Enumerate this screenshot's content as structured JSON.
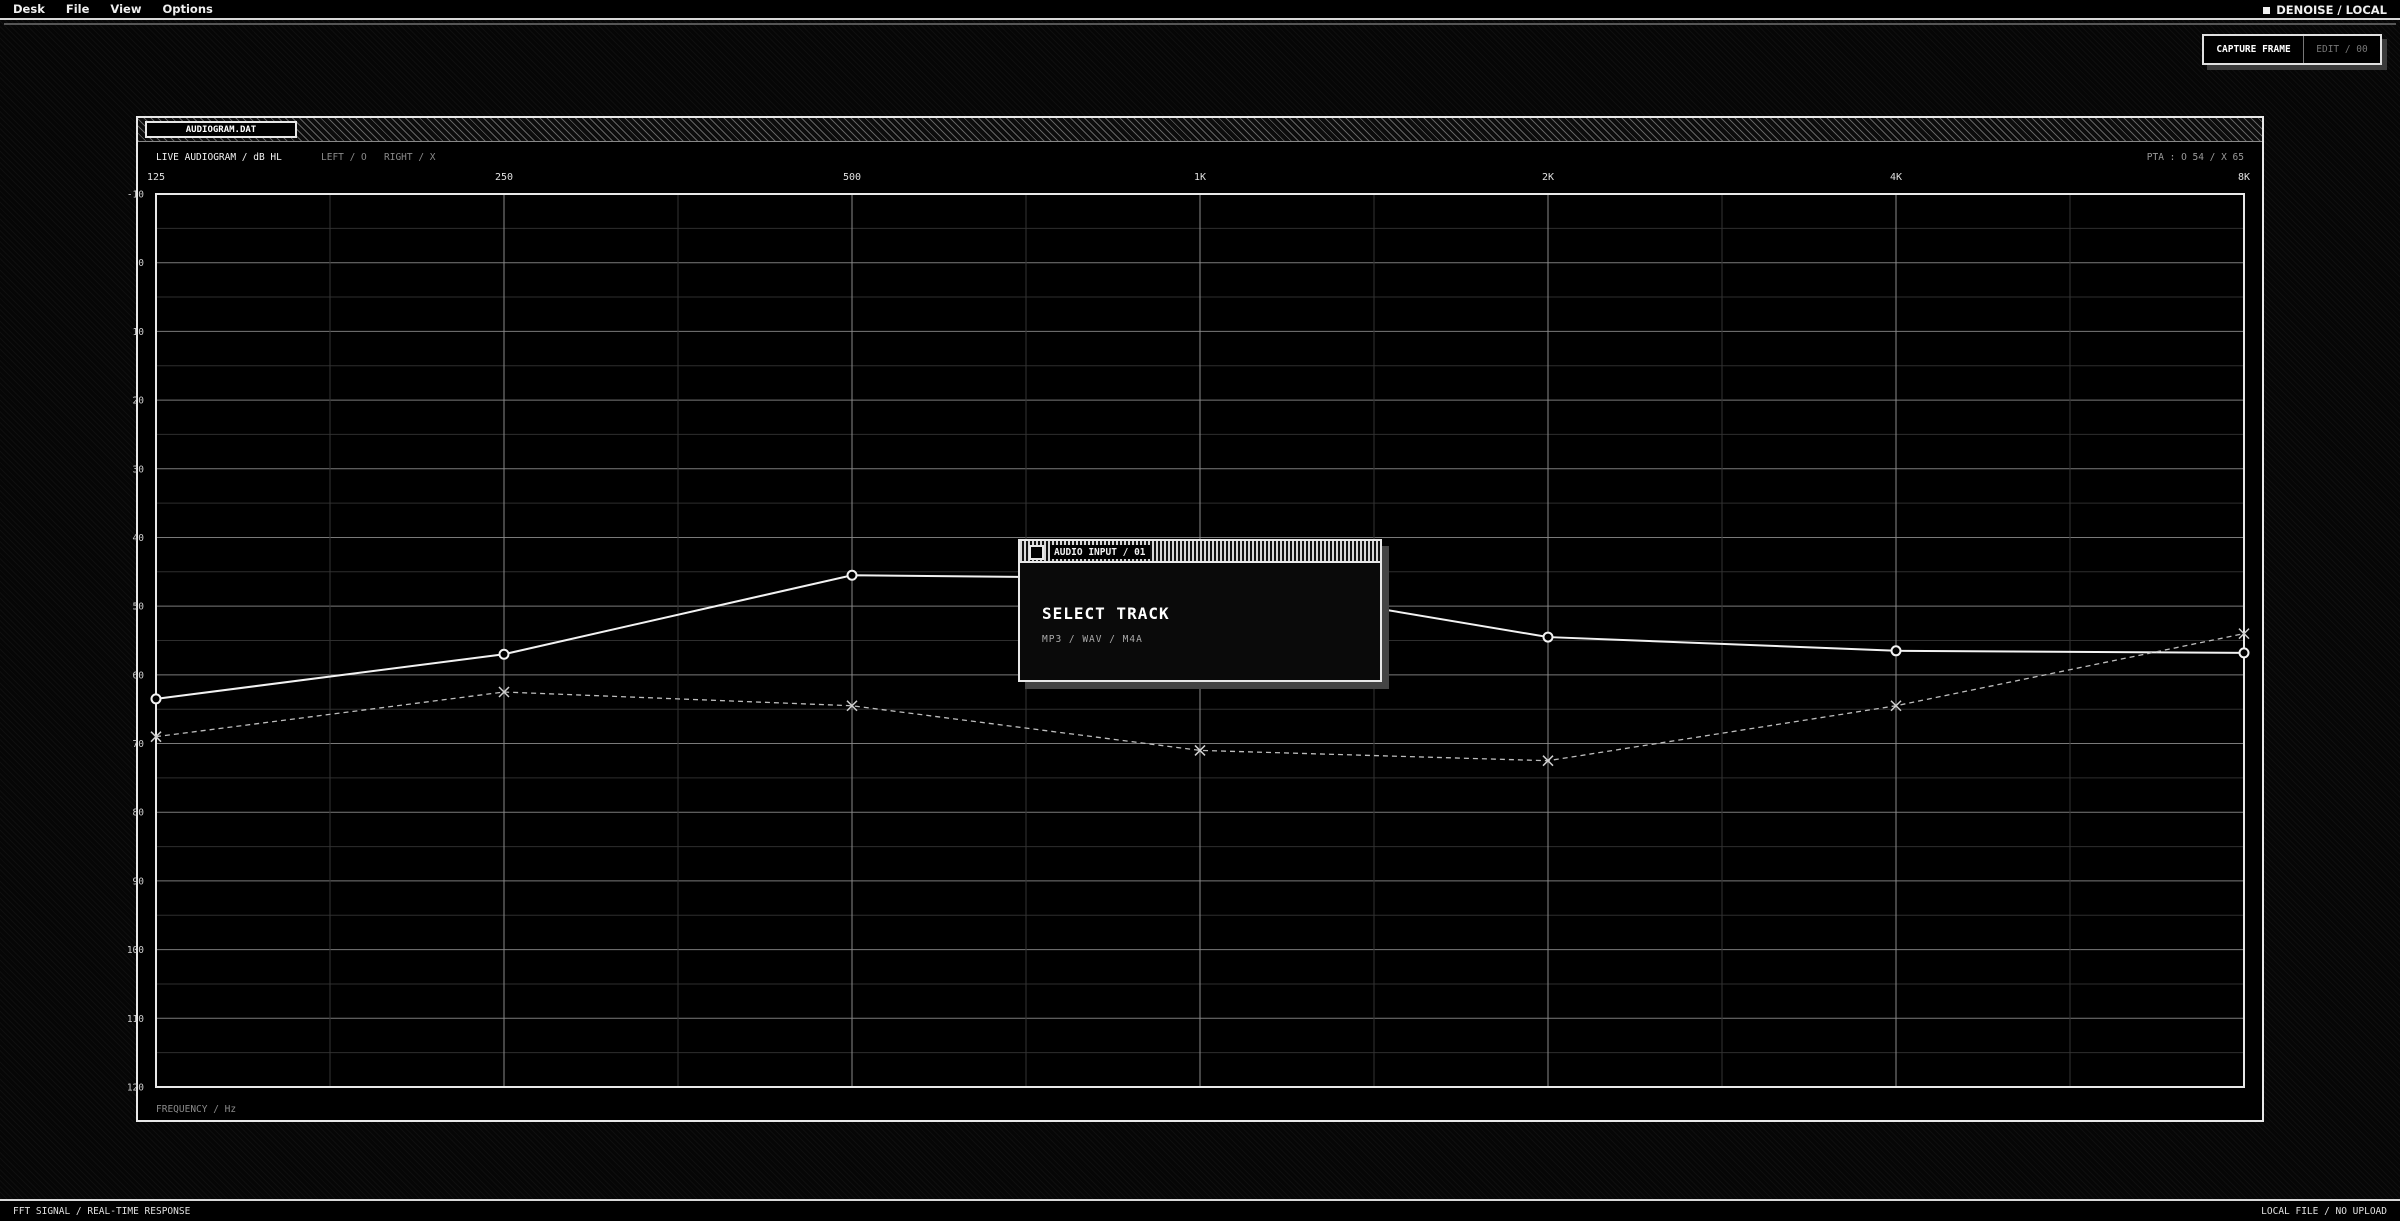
{
  "menubar": {
    "items": [
      "Desk",
      "File",
      "View",
      "Options"
    ],
    "status": "DENOISE / LOCAL"
  },
  "capture": {
    "primary_label": "CAPTURE FRAME",
    "secondary_label": "EDIT / 00"
  },
  "panel": {
    "file_tab": "AUDIOGRAM.DAT",
    "legend_title": "LIVE AUDIOGRAM / dB HL",
    "legend_left": "LEFT / O",
    "legend_right": "RIGHT / X",
    "pta": "PTA : O 54 / X 65",
    "x_caption": "FREQUENCY / Hz"
  },
  "chart_data": {
    "type": "line",
    "x_ticks": [
      "125",
      "250",
      "500",
      "1K",
      "2K",
      "4K",
      "8K"
    ],
    "y_ticks": [
      "-10",
      "0",
      "10",
      "20",
      "30",
      "40",
      "50",
      "60",
      "70",
      "80",
      "90",
      "100",
      "110",
      "120"
    ],
    "ylim": [
      -10,
      120
    ],
    "y_inverted": true,
    "x_scale": "log2",
    "grid": true,
    "series": [
      {
        "name": "LEFT / O",
        "marker": "circle",
        "style": "solid",
        "values": [
          63.5,
          57,
          45.5,
          46,
          54.5,
          56.5,
          56.8
        ]
      },
      {
        "name": "RIGHT / X",
        "marker": "x",
        "style": "dashed",
        "values": [
          69,
          62.5,
          64.5,
          71,
          72.5,
          64.5,
          54
        ]
      }
    ]
  },
  "dialog": {
    "title": "AUDIO INPUT / 01",
    "heading": "SELECT TRACK",
    "formats": "MP3 / WAV / M4A"
  },
  "footer": {
    "left": "FFT SIGNAL / REAL-TIME RESPONSE",
    "right": "LOCAL FILE / NO UPLOAD"
  }
}
